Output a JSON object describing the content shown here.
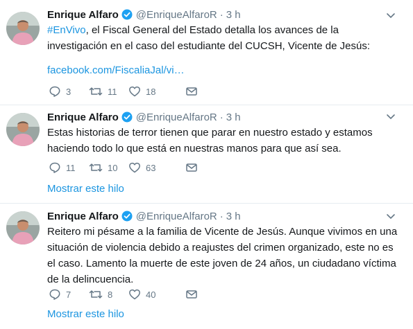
{
  "tweets": [
    {
      "author_name": "Enrique Alfaro",
      "handle": "@EnriqueAlfaroR",
      "separator": "·",
      "time": "3 h",
      "hashtag": "#EnVivo",
      "text": ", el Fiscal General del Estado detalla los avances de la investigación en el caso del estudiante del CUCSH, Vicente de Jesús:",
      "link": "facebook.com/FiscaliaJal/vi…",
      "replies": "3",
      "retweets": "11",
      "likes": "18",
      "show_thread": ""
    },
    {
      "author_name": "Enrique Alfaro",
      "handle": "@EnriqueAlfaroR",
      "separator": "·",
      "time": "3 h",
      "text": "Estas historias de terror tienen que parar en nuestro estado y estamos haciendo todo lo que está en nuestras manos para que así sea.",
      "replies": "11",
      "retweets": "10",
      "likes": "63",
      "show_thread": "Mostrar este hilo"
    },
    {
      "author_name": "Enrique Alfaro",
      "handle": "@EnriqueAlfaroR",
      "separator": "·",
      "time": "3 h",
      "text": "Reitero mi pésame a la familia de Vicente de Jesús. Aunque vivimos en una situación de violencia debido a reajustes del crimen organizado, este no es el caso. Lamento la muerte de este joven de 24 años, un ciudadano víctima de la delincuencia.",
      "replies": "7",
      "retweets": "8",
      "likes": "40",
      "show_thread": "Mostrar este hilo"
    }
  ],
  "colors": {
    "link": "#1b95e0",
    "muted": "#657786",
    "text": "#14171a",
    "divider": "#e6ecf0",
    "verified": "#1da1f2"
  },
  "icons": [
    "avatar",
    "verified-badge-icon",
    "chevron-down-icon",
    "reply-icon",
    "retweet-icon",
    "like-icon",
    "direct-message-icon"
  ]
}
